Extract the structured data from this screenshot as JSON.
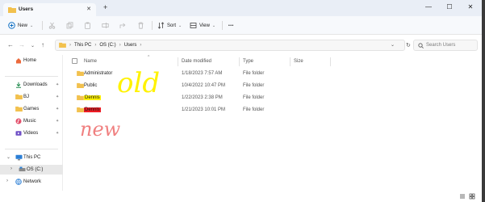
{
  "colors": {
    "folder": "#f2c14e",
    "accent": "#0067c0",
    "highlight_yellow": "#fff200",
    "highlight_red": "#ee1c24",
    "ink_yellow": "#fff200",
    "ink_red": "#f08080"
  },
  "window": {
    "tab_title": "Users",
    "tab_icon": "folder-icon",
    "new_tab": "+",
    "controls": {
      "minimize": "—",
      "maximize": "☐",
      "close": "✕"
    }
  },
  "commandbar": {
    "new_label": "New",
    "sort_label": "Sort",
    "view_label": "View",
    "more_label": "•••",
    "icons": [
      "cut-icon",
      "copy-icon",
      "paste-icon",
      "rename-icon",
      "share-icon",
      "delete-icon"
    ]
  },
  "address": {
    "crumbs": [
      "This PC",
      "OS (C:)",
      "Users"
    ],
    "search_placeholder": "Search Users"
  },
  "sidebar": {
    "home": "Home",
    "quick_access": [
      {
        "label": "Downloads",
        "icon": "download-icon"
      },
      {
        "label": "BJ",
        "icon": "folder-icon"
      },
      {
        "label": "Games",
        "icon": "folder-icon"
      },
      {
        "label": "Music",
        "icon": "music-icon"
      },
      {
        "label": "Videos",
        "icon": "video-icon"
      }
    ],
    "this_pc": "This PC",
    "drive": "OS (C:)",
    "network": "Network"
  },
  "columns": {
    "name": "Name",
    "date": "Date modified",
    "type": "Type",
    "size": "Size"
  },
  "rows": [
    {
      "name": "Administrator",
      "date": "1/18/2023 7:57 AM",
      "type": "File folder",
      "highlight": ""
    },
    {
      "name": "Public",
      "date": "10/4/2022 10:47 PM",
      "type": "File folder",
      "highlight": ""
    },
    {
      "name": "Dennis",
      "date": "1/22/2023 2:38 PM",
      "type": "File folder",
      "highlight": "yellow"
    },
    {
      "name": "Dennis",
      "date": "1/21/2023 10:01 PM",
      "type": "File folder",
      "highlight": "red"
    }
  ],
  "annotations": {
    "old": "old",
    "new": "new"
  }
}
